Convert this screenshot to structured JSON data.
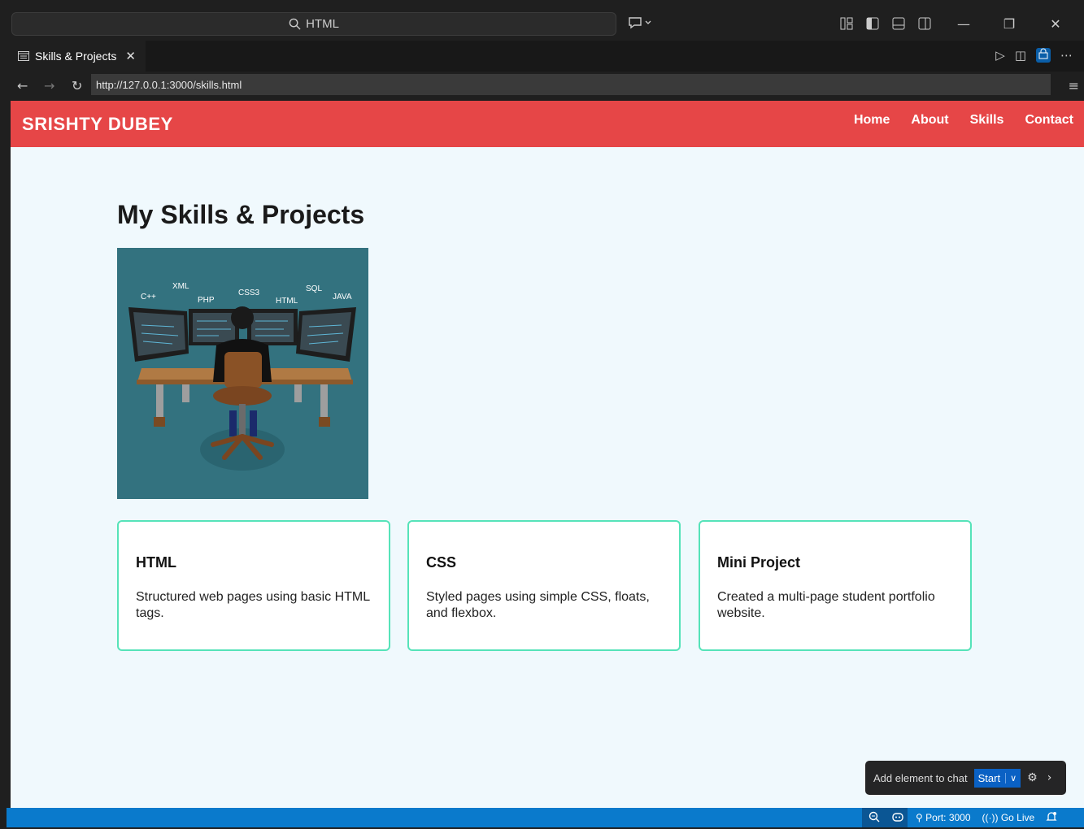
{
  "window": {
    "search_text": "HTML"
  },
  "tab": {
    "title": "Skills & Projects",
    "close_glyph": "✕"
  },
  "address": {
    "url": "http://127.0.0.1:3000/skills.html"
  },
  "site": {
    "brand": "SRISHTY DUBEY",
    "nav": [
      "Home",
      "About",
      "Skills",
      "Contact"
    ],
    "page_title": "My Skills & Projects",
    "hero_labels": [
      "XML",
      "C++",
      "PHP",
      "CSS3",
      "HTML",
      "SQL",
      "JAVA"
    ],
    "cards": [
      {
        "title": "HTML",
        "text": "Structured web pages using basic HTML tags."
      },
      {
        "title": "CSS",
        "text": "Styled pages using simple CSS, floats, and flexbox."
      },
      {
        "title": "Mini Project",
        "text": "Created a multi-page student portfolio website."
      }
    ]
  },
  "chat_popup": {
    "label": "Add element to chat",
    "start": "Start"
  },
  "status": {
    "port": "Port: 3000",
    "go_live": "Go Live"
  },
  "colors": {
    "nav_bg": "#e64647",
    "page_bg": "#f0f9fd",
    "card_border": "#56e3b9",
    "status_bar": "#0a7acc"
  }
}
